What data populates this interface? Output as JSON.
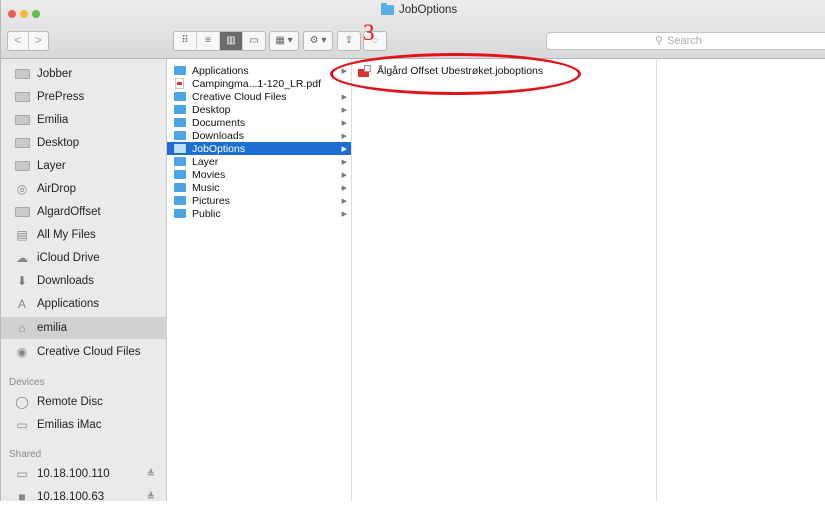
{
  "window": {
    "title": "JobOptions"
  },
  "toolbar": {
    "back": "<",
    "forward": ">",
    "views": [
      "⠿",
      "≡",
      "▥",
      "▭"
    ],
    "arrange_icon": "▦ ▾",
    "action_icon": "⚙ ▾",
    "step_number": "3",
    "search_placeholder": "Search"
  },
  "sidebar": {
    "favorites": [
      {
        "label": "Jobber",
        "icon": "folder-icon"
      },
      {
        "label": "PrePress",
        "icon": "folder-icon"
      },
      {
        "label": "Emilia",
        "icon": "folder-icon"
      },
      {
        "label": "Desktop",
        "icon": "folder-icon"
      },
      {
        "label": "Layer",
        "icon": "folder-icon"
      },
      {
        "label": "AirDrop",
        "icon": "airdrop-icon"
      },
      {
        "label": "AlgardOffset",
        "icon": "folder-icon"
      },
      {
        "label": "All My Files",
        "icon": "all-files-icon"
      },
      {
        "label": "iCloud Drive",
        "icon": "cloud-icon"
      },
      {
        "label": "Downloads",
        "icon": "downloads-icon"
      },
      {
        "label": "Applications",
        "icon": "applications-icon"
      },
      {
        "label": "emilia",
        "icon": "home-icon"
      },
      {
        "label": "Creative Cloud Files",
        "icon": "creative-cloud-icon"
      }
    ],
    "devices_header": "Devices",
    "devices": [
      {
        "label": "Remote Disc",
        "icon": "disc-icon"
      },
      {
        "label": "Emilias iMac",
        "icon": "imac-icon"
      }
    ],
    "shared_header": "Shared",
    "shared": [
      {
        "label": "10.18.100.110",
        "icon": "server-icon"
      },
      {
        "label": "10.18.100.63",
        "icon": "server-icon"
      }
    ]
  },
  "column1": {
    "items": [
      {
        "label": "Applications",
        "type": "folder",
        "has_children": true
      },
      {
        "label": "Campingma...1-120_LR.pdf",
        "type": "pdf",
        "has_children": false
      },
      {
        "label": "Creative Cloud Files",
        "type": "folder",
        "has_children": true
      },
      {
        "label": "Desktop",
        "type": "folder",
        "has_children": true
      },
      {
        "label": "Documents",
        "type": "folder",
        "has_children": true
      },
      {
        "label": "Downloads",
        "type": "folder",
        "has_children": true
      },
      {
        "label": "JobOptions",
        "type": "folder",
        "has_children": true,
        "selected": true
      },
      {
        "label": "Layer",
        "type": "folder",
        "has_children": true
      },
      {
        "label": "Movies",
        "type": "folder",
        "has_children": true
      },
      {
        "label": "Music",
        "type": "folder",
        "has_children": true
      },
      {
        "label": "Pictures",
        "type": "folder",
        "has_children": true
      },
      {
        "label": "Public",
        "type": "folder",
        "has_children": true
      }
    ]
  },
  "column2": {
    "items": [
      {
        "label": "Ålgård Offset Ubestrøket.joboptions",
        "type": "joboptions"
      }
    ]
  },
  "colors": {
    "selection": "#1e6ecf",
    "annotation": "#e11219",
    "folder": "#4ba4e6"
  }
}
